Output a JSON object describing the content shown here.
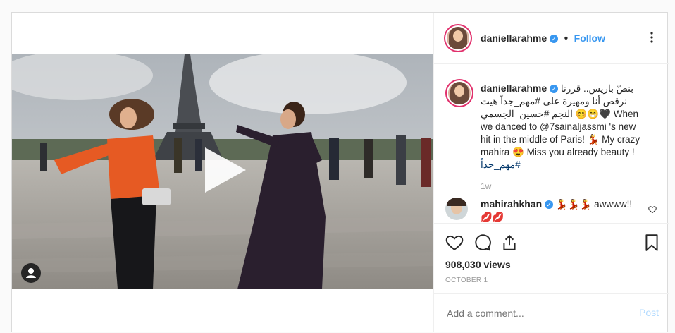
{
  "header": {
    "username": "daniellarahme",
    "follow_label": "Follow",
    "more_icon": "more-horizontal-icon"
  },
  "caption": {
    "username": "daniellarahme",
    "line1": "بنصّ باريس.. قررنا",
    "line2": "نرقص أنا ومهيرة على #مهم_جداً هيت",
    "line3_rtl": "النجم #حسين_الجسمي",
    "line3_ltr": "When",
    "line4": "we danced to @7sainaljassmi 's new",
    "line5": "hit in the middle of Paris! 💃 My crazy",
    "line6": "mahira 😍 Miss you already beauty !",
    "line7": "#مهم_جداً",
    "time": "1w"
  },
  "comment": {
    "username": "mahirahkhan",
    "text": "awwww!!"
  },
  "stats": {
    "views": "908,030 views",
    "date": "OCTOBER 1"
  },
  "comment_box": {
    "placeholder": "Add a comment...",
    "post_label": "Post"
  },
  "colors": {
    "accent": "#3897f0",
    "text": "#262626",
    "muted": "#999999",
    "border": "#dbdbdb"
  }
}
